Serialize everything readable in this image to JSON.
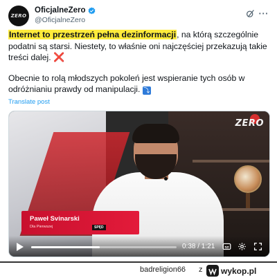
{
  "post": {
    "display_name": "OficjalneZero",
    "handle": "@OficjalneZero",
    "avatar_text": "ZERO",
    "text_highlight": "Internet to przestrzeń pełna dezinformacji",
    "text_line1_rest": ", na którą szczególnie podatni są starsi. Niestety, to właśnie oni najczęściej przekazują takie treści dalej.",
    "red_x": "❌",
    "text_paragraph2": "Obecnie to rolą młodszych pokoleń jest wspieranie tych osób w odróżnianiu prawdy od manipulacji.",
    "arrow_emoji": "⤵",
    "translate_label": "Translate post",
    "more_label": "···",
    "icons": [
      "avatar",
      "verified-icon",
      "grok-icon",
      "more-icon"
    ]
  },
  "video": {
    "channel_logo": "ZERO",
    "lower_third_name": "Paweł Svinarski",
    "lower_third_role": "Dla Pierwszej",
    "lower_third_small": "SPĘD",
    "time_display": "0:38 / 1:21",
    "progress": 0.47,
    "icons": [
      "play-icon",
      "captions-icon",
      "settings-icon",
      "fullscreen-icon"
    ]
  },
  "footer": {
    "username": "badreligion66",
    "z": "z",
    "site_name": "wykop.pl"
  },
  "colors": {
    "highlight": "#ffeb3b",
    "link": "#1d9bf0",
    "verified": "#1d9bf0",
    "lower_third": "#c8102e"
  }
}
